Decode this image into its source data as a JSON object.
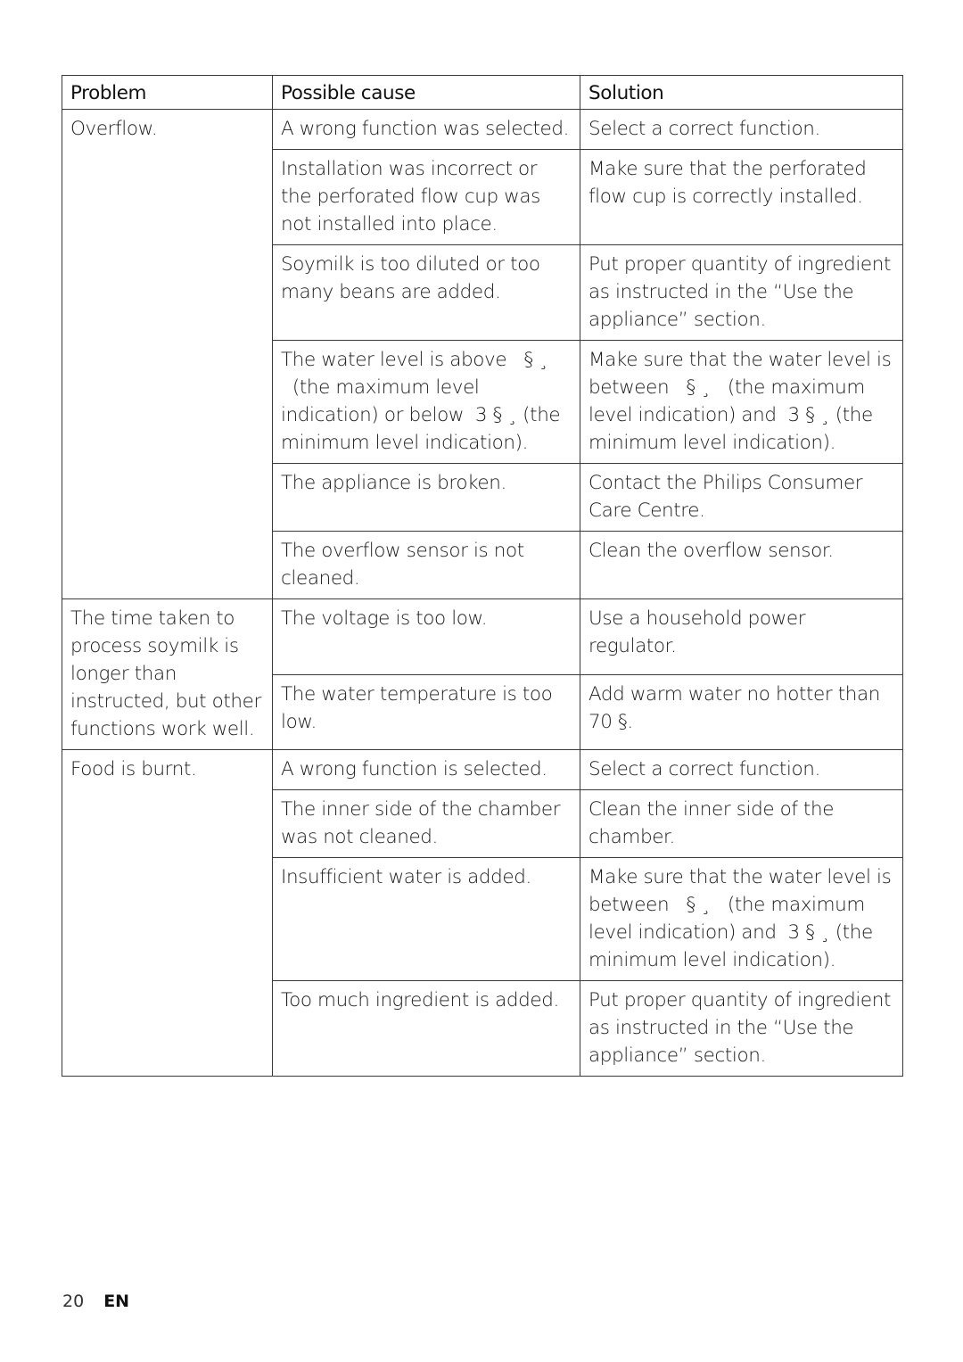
{
  "table": {
    "headers": [
      "Problem",
      "Possible cause",
      "Solution"
    ],
    "groups": [
      {
        "problem": "Overflow.",
        "rows": [
          {
            "cause": "A wrong function was selected.",
            "solution": "Select a correct function."
          },
          {
            "cause": "Installation was incorrect or the perforated flow cup was not installed into place.",
            "solution": "Make sure that the perforated flow cup is correctly installed."
          },
          {
            "cause": "Soymilk is too diluted or too many beans are added.",
            "solution": "Put proper quantity of ingredient as instructed in the “Use the appliance” section."
          },
          {
            "cause": "The water level is above   § ¸   (the maximum level indication) or below  3 § ¸ (the minimum level indication).",
            "solution": "Make sure that the water level is between   § ¸   (the maximum level indication) and  3 § ¸ (the minimum level indication)."
          },
          {
            "cause": "The appliance is broken.",
            "solution": "Contact the Philips Consumer Care Centre."
          },
          {
            "cause": "The overflow sensor is not cleaned.",
            "solution": "Clean the overflow sensor."
          }
        ]
      },
      {
        "problem": "The time taken to process soymilk is longer than instructed, but other functions work well.",
        "rows": [
          {
            "cause": "The voltage is too low.",
            "solution": "Use a household power regulator."
          },
          {
            "cause": "The water temperature is too low.",
            "solution": "Add warm water no hotter than 70 §."
          }
        ]
      },
      {
        "problem": "Food is burnt.",
        "rows": [
          {
            "cause": "A wrong function is selected.",
            "solution": "Select a correct function."
          },
          {
            "cause": "The inner side of the chamber was not cleaned.",
            "solution": "Clean the inner side of the chamber."
          },
          {
            "cause": "Insufficient water is added.",
            "solution": "Make sure that the water level is between   § ¸   (the maximum level indication) and  3 § ¸ (the minimum level indication)."
          },
          {
            "cause": "Too much ingredient is added.",
            "solution": "Put proper quantity of ingredient as instructed in the “Use the appliance” section."
          }
        ]
      }
    ]
  },
  "footer": {
    "page_number": "20",
    "language": "EN"
  }
}
